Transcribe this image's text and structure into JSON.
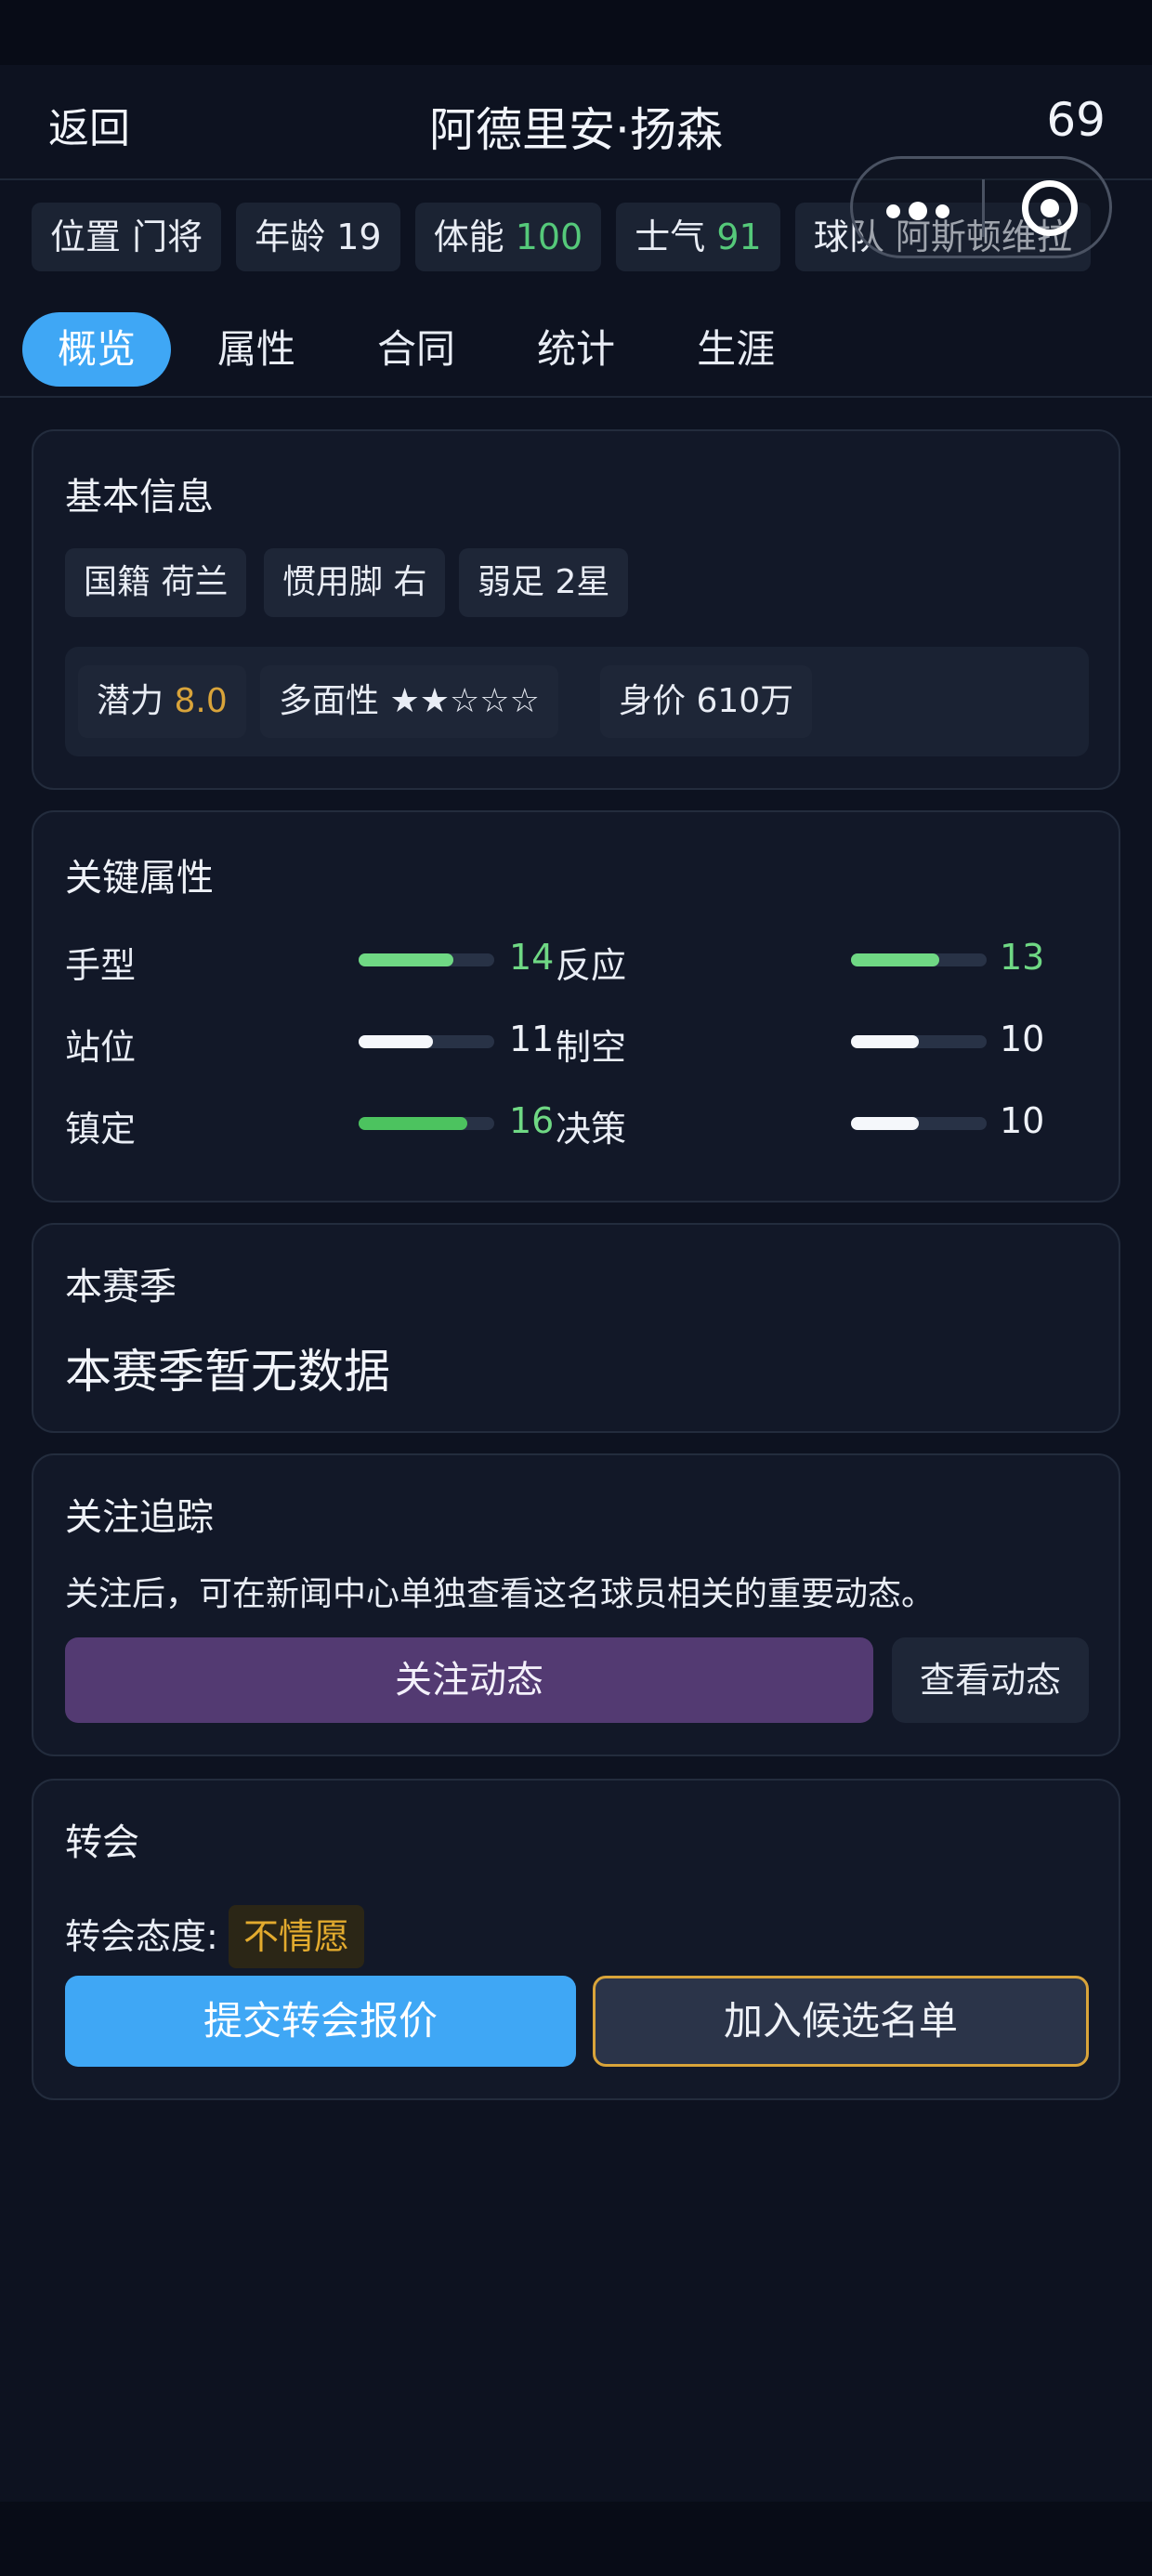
{
  "header": {
    "back_label": "返回",
    "title": "阿德里安·扬森",
    "rating": "69"
  },
  "chips": {
    "position_label": "位置",
    "position_value": "门将",
    "age_label": "年龄",
    "age_value": "19",
    "stamina_label": "体能",
    "stamina_value": "100",
    "morale_label": "士气",
    "morale_value": "91",
    "team_label": "球队",
    "team_value": "阿斯顿维拉"
  },
  "tabs": [
    "概览",
    "属性",
    "合同",
    "统计",
    "生涯"
  ],
  "basic_info": {
    "title": "基本信息",
    "nationality_label": "国籍",
    "nationality_value": "荷兰",
    "foot_label": "惯用脚",
    "foot_value": "右",
    "weak_foot_label": "弱足",
    "weak_foot_value": "2星",
    "potential_label": "潜力",
    "potential_value": "8.0",
    "versatility_label": "多面性",
    "versatility_stars": "★★☆☆☆",
    "value_label": "身价",
    "value_value": "610万"
  },
  "key_attributes": {
    "title": "关键属性",
    "scale_max": 20,
    "items": [
      {
        "name": "手型",
        "value": 14
      },
      {
        "name": "反应",
        "value": 13
      },
      {
        "name": "站位",
        "value": 11
      },
      {
        "name": "制空",
        "value": 10
      },
      {
        "name": "镇定",
        "value": 16
      },
      {
        "name": "决策",
        "value": 10
      }
    ]
  },
  "season": {
    "title": "本赛季",
    "empty_text": "本赛季暂无数据"
  },
  "follow": {
    "title": "关注追踪",
    "description": "关注后，可在新闻中心单独查看这名球员相关的重要动态。",
    "follow_button": "关注动态",
    "view_button": "查看动态"
  },
  "transfer": {
    "title": "转会",
    "attitude_label": "转会态度:",
    "attitude_value": "不情愿",
    "offer_button": "提交转会报价",
    "shortlist_button": "加入候选名单"
  },
  "colors": {
    "accent_blue": "#3fa7f5",
    "gold": "#d9a43a",
    "green": "#6fd884",
    "purple": "#533a72"
  }
}
